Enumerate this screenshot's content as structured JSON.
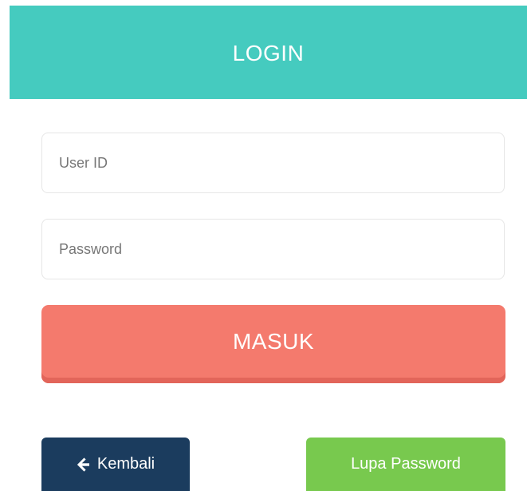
{
  "header": {
    "title": "LOGIN"
  },
  "form": {
    "user_id": {
      "value": "",
      "placeholder": "User ID"
    },
    "password": {
      "value": "",
      "placeholder": "Password"
    },
    "submit_label": "MASUK"
  },
  "footer": {
    "back_label": "Kembali",
    "back_icon": "arrow-left-icon",
    "forgot_label": "Lupa Password"
  },
  "colors": {
    "header_bg": "#45cbbf",
    "submit_bg": "#f47a6d",
    "back_bg": "#1b3c5e",
    "forgot_bg": "#78c94e"
  }
}
